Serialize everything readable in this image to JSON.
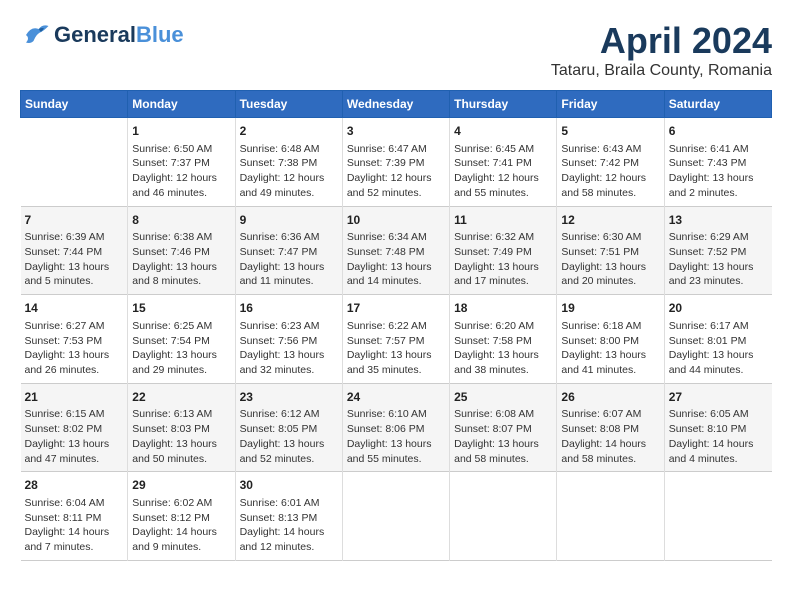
{
  "logo": {
    "line1": "General",
    "line2": "Blue"
  },
  "title": "April 2024",
  "location": "Tataru, Braila County, Romania",
  "headers": [
    "Sunday",
    "Monday",
    "Tuesday",
    "Wednesday",
    "Thursday",
    "Friday",
    "Saturday"
  ],
  "weeks": [
    [
      {
        "day": "",
        "info": ""
      },
      {
        "day": "1",
        "info": "Sunrise: 6:50 AM\nSunset: 7:37 PM\nDaylight: 12 hours\nand 46 minutes."
      },
      {
        "day": "2",
        "info": "Sunrise: 6:48 AM\nSunset: 7:38 PM\nDaylight: 12 hours\nand 49 minutes."
      },
      {
        "day": "3",
        "info": "Sunrise: 6:47 AM\nSunset: 7:39 PM\nDaylight: 12 hours\nand 52 minutes."
      },
      {
        "day": "4",
        "info": "Sunrise: 6:45 AM\nSunset: 7:41 PM\nDaylight: 12 hours\nand 55 minutes."
      },
      {
        "day": "5",
        "info": "Sunrise: 6:43 AM\nSunset: 7:42 PM\nDaylight: 12 hours\nand 58 minutes."
      },
      {
        "day": "6",
        "info": "Sunrise: 6:41 AM\nSunset: 7:43 PM\nDaylight: 13 hours\nand 2 minutes."
      }
    ],
    [
      {
        "day": "7",
        "info": "Sunrise: 6:39 AM\nSunset: 7:44 PM\nDaylight: 13 hours\nand 5 minutes."
      },
      {
        "day": "8",
        "info": "Sunrise: 6:38 AM\nSunset: 7:46 PM\nDaylight: 13 hours\nand 8 minutes."
      },
      {
        "day": "9",
        "info": "Sunrise: 6:36 AM\nSunset: 7:47 PM\nDaylight: 13 hours\nand 11 minutes."
      },
      {
        "day": "10",
        "info": "Sunrise: 6:34 AM\nSunset: 7:48 PM\nDaylight: 13 hours\nand 14 minutes."
      },
      {
        "day": "11",
        "info": "Sunrise: 6:32 AM\nSunset: 7:49 PM\nDaylight: 13 hours\nand 17 minutes."
      },
      {
        "day": "12",
        "info": "Sunrise: 6:30 AM\nSunset: 7:51 PM\nDaylight: 13 hours\nand 20 minutes."
      },
      {
        "day": "13",
        "info": "Sunrise: 6:29 AM\nSunset: 7:52 PM\nDaylight: 13 hours\nand 23 minutes."
      }
    ],
    [
      {
        "day": "14",
        "info": "Sunrise: 6:27 AM\nSunset: 7:53 PM\nDaylight: 13 hours\nand 26 minutes."
      },
      {
        "day": "15",
        "info": "Sunrise: 6:25 AM\nSunset: 7:54 PM\nDaylight: 13 hours\nand 29 minutes."
      },
      {
        "day": "16",
        "info": "Sunrise: 6:23 AM\nSunset: 7:56 PM\nDaylight: 13 hours\nand 32 minutes."
      },
      {
        "day": "17",
        "info": "Sunrise: 6:22 AM\nSunset: 7:57 PM\nDaylight: 13 hours\nand 35 minutes."
      },
      {
        "day": "18",
        "info": "Sunrise: 6:20 AM\nSunset: 7:58 PM\nDaylight: 13 hours\nand 38 minutes."
      },
      {
        "day": "19",
        "info": "Sunrise: 6:18 AM\nSunset: 8:00 PM\nDaylight: 13 hours\nand 41 minutes."
      },
      {
        "day": "20",
        "info": "Sunrise: 6:17 AM\nSunset: 8:01 PM\nDaylight: 13 hours\nand 44 minutes."
      }
    ],
    [
      {
        "day": "21",
        "info": "Sunrise: 6:15 AM\nSunset: 8:02 PM\nDaylight: 13 hours\nand 47 minutes."
      },
      {
        "day": "22",
        "info": "Sunrise: 6:13 AM\nSunset: 8:03 PM\nDaylight: 13 hours\nand 50 minutes."
      },
      {
        "day": "23",
        "info": "Sunrise: 6:12 AM\nSunset: 8:05 PM\nDaylight: 13 hours\nand 52 minutes."
      },
      {
        "day": "24",
        "info": "Sunrise: 6:10 AM\nSunset: 8:06 PM\nDaylight: 13 hours\nand 55 minutes."
      },
      {
        "day": "25",
        "info": "Sunrise: 6:08 AM\nSunset: 8:07 PM\nDaylight: 13 hours\nand 58 minutes."
      },
      {
        "day": "26",
        "info": "Sunrise: 6:07 AM\nSunset: 8:08 PM\nDaylight: 14 hours\nand 58 minutes."
      },
      {
        "day": "27",
        "info": "Sunrise: 6:05 AM\nSunset: 8:10 PM\nDaylight: 14 hours\nand 4 minutes."
      }
    ],
    [
      {
        "day": "28",
        "info": "Sunrise: 6:04 AM\nSunset: 8:11 PM\nDaylight: 14 hours\nand 7 minutes."
      },
      {
        "day": "29",
        "info": "Sunrise: 6:02 AM\nSunset: 8:12 PM\nDaylight: 14 hours\nand 9 minutes."
      },
      {
        "day": "30",
        "info": "Sunrise: 6:01 AM\nSunset: 8:13 PM\nDaylight: 14 hours\nand 12 minutes."
      },
      {
        "day": "",
        "info": ""
      },
      {
        "day": "",
        "info": ""
      },
      {
        "day": "",
        "info": ""
      },
      {
        "day": "",
        "info": ""
      }
    ]
  ]
}
